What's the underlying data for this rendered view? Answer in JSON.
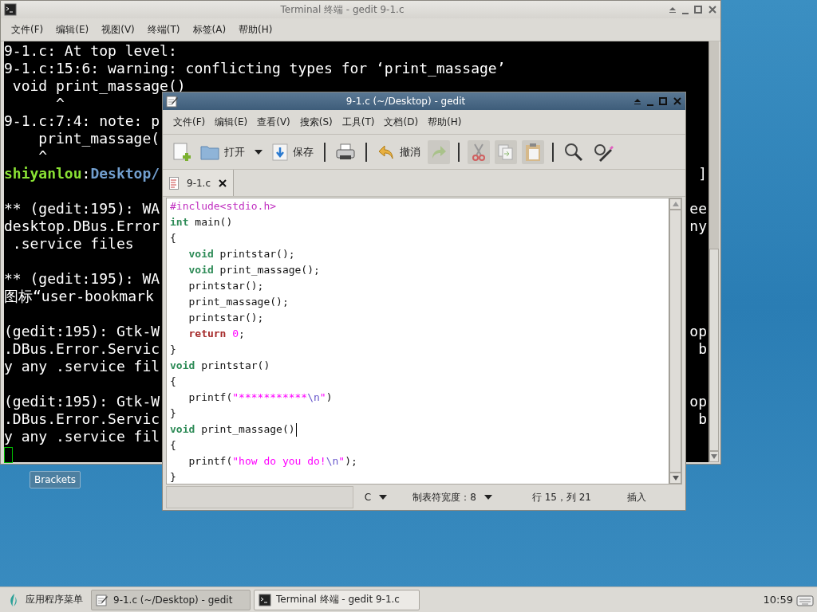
{
  "terminal": {
    "title": "Terminal 终端 - gedit 9-1.c",
    "menu": [
      "文件(F)",
      "编辑(E)",
      "视图(V)",
      "终端(T)",
      "标签(A)",
      "帮助(H)"
    ],
    "lines": [
      {
        "kind": "text",
        "segments": [
          {
            "text": "9-1.c: At top level:",
            "kind": "plain"
          }
        ]
      },
      {
        "kind": "text",
        "segments": [
          {
            "text": "9-1.c:15:6: warning: conflicting types for ‘print_massage’",
            "kind": "plain"
          }
        ]
      },
      {
        "kind": "text",
        "segments": [
          {
            "text": " void print_massage()",
            "kind": "plain"
          }
        ]
      },
      {
        "kind": "text",
        "segments": [
          {
            "text": "      ^",
            "kind": "plain"
          }
        ]
      },
      {
        "kind": "text",
        "segments": [
          {
            "text": "9-1.c:7:4: note: p",
            "kind": "plain"
          }
        ]
      },
      {
        "kind": "text",
        "segments": [
          {
            "text": "    print_massage(",
            "kind": "plain"
          }
        ]
      },
      {
        "kind": "text",
        "segments": [
          {
            "text": "    ^",
            "kind": "plain"
          }
        ]
      },
      {
        "kind": "text",
        "segments": [
          {
            "text": "shiyanlou",
            "kind": "user"
          },
          {
            "text": ":",
            "kind": "plain"
          },
          {
            "text": "Desktop/",
            "kind": "path"
          }
        ],
        "right": "]"
      },
      {
        "kind": "blank"
      },
      {
        "kind": "text",
        "segments": [
          {
            "text": "** (gedit:195): WA",
            "kind": "plain"
          }
        ],
        "right": "ee"
      },
      {
        "kind": "text",
        "segments": [
          {
            "text": "desktop.DBus.Error",
            "kind": "plain"
          }
        ],
        "right": "ny"
      },
      {
        "kind": "text",
        "segments": [
          {
            "text": " .service files",
            "kind": "plain"
          }
        ]
      },
      {
        "kind": "blank"
      },
      {
        "kind": "text",
        "segments": [
          {
            "text": "** (gedit:195): WA",
            "kind": "plain"
          }
        ]
      },
      {
        "kind": "text",
        "segments": [
          {
            "text": "图标“user-bookmark",
            "kind": "plain"
          }
        ]
      },
      {
        "kind": "blank"
      },
      {
        "kind": "text",
        "segments": [
          {
            "text": "(gedit:195): Gtk-W",
            "kind": "plain"
          }
        ],
        "right": "op"
      },
      {
        "kind": "text",
        "segments": [
          {
            "text": ".DBus.Error.Servic",
            "kind": "plain"
          }
        ],
        "right": "b"
      },
      {
        "kind": "text",
        "segments": [
          {
            "text": "y any .service fil",
            "kind": "plain"
          }
        ]
      },
      {
        "kind": "blank"
      },
      {
        "kind": "text",
        "segments": [
          {
            "text": "(gedit:195): Gtk-W",
            "kind": "plain"
          }
        ],
        "right": "op"
      },
      {
        "kind": "text",
        "segments": [
          {
            "text": ".DBus.Error.Servic",
            "kind": "plain"
          }
        ],
        "right": "b"
      },
      {
        "kind": "text",
        "segments": [
          {
            "text": "y any .service fil",
            "kind": "plain"
          }
        ]
      }
    ],
    "cursor": true
  },
  "tooltip": "Brackets",
  "gedit": {
    "title": "9-1.c (~/Desktop) - gedit",
    "menu": [
      "文件(F)",
      "编辑(E)",
      "查看(V)",
      "搜索(S)",
      "工具(T)",
      "文档(D)",
      "帮助(H)"
    ],
    "toolbar": {
      "open_label": "打开",
      "save_label": "保存",
      "undo_label": "撤消",
      "redo_disabled": true,
      "cut_disabled": true,
      "copy_disabled": true,
      "paste_disabled": true
    },
    "tabs": [
      {
        "label": "9-1.c",
        "selected": true
      }
    ],
    "code": [
      {
        "caret": false,
        "tokens": [
          {
            "kind": "preproc",
            "text": "#include<stdio.h>"
          }
        ]
      },
      {
        "caret": false,
        "tokens": [
          {
            "kind": "type",
            "text": "int"
          },
          {
            "kind": "plain",
            "text": " main()"
          }
        ]
      },
      {
        "caret": false,
        "tokens": [
          {
            "kind": "plain",
            "text": "{"
          }
        ]
      },
      {
        "caret": false,
        "tokens": [
          {
            "kind": "type",
            "text": "   void"
          },
          {
            "kind": "plain",
            "text": " printstar();"
          }
        ]
      },
      {
        "caret": false,
        "tokens": [
          {
            "kind": "type",
            "text": "   void"
          },
          {
            "kind": "plain",
            "text": " print_massage();"
          }
        ]
      },
      {
        "caret": false,
        "tokens": [
          {
            "kind": "plain",
            "text": "   printstar();"
          }
        ]
      },
      {
        "caret": false,
        "tokens": [
          {
            "kind": "plain",
            "text": "   print_massage();"
          }
        ]
      },
      {
        "caret": false,
        "tokens": [
          {
            "kind": "plain",
            "text": "   printstar();"
          }
        ]
      },
      {
        "caret": false,
        "tokens": [
          {
            "kind": "keyword",
            "text": "   return"
          },
          {
            "kind": "number",
            "text": " 0"
          },
          {
            "kind": "plain",
            "text": ";"
          }
        ]
      },
      {
        "caret": false,
        "tokens": [
          {
            "kind": "plain",
            "text": "}"
          }
        ]
      },
      {
        "caret": false,
        "tokens": [
          {
            "kind": "type",
            "text": "void"
          },
          {
            "kind": "plain",
            "text": " printstar()"
          }
        ]
      },
      {
        "caret": false,
        "tokens": [
          {
            "kind": "plain",
            "text": "{"
          }
        ]
      },
      {
        "caret": false,
        "tokens": [
          {
            "kind": "plain",
            "text": "   printf("
          },
          {
            "kind": "string",
            "text": "\"***********"
          },
          {
            "kind": "escape",
            "text": "\\n"
          },
          {
            "kind": "string",
            "text": "\""
          },
          {
            "kind": "plain",
            "text": ")"
          }
        ]
      },
      {
        "caret": false,
        "tokens": [
          {
            "kind": "plain",
            "text": "}"
          }
        ]
      },
      {
        "caret": true,
        "tokens": [
          {
            "kind": "type",
            "text": "void"
          },
          {
            "kind": "plain",
            "text": " print_massage()"
          }
        ]
      },
      {
        "caret": false,
        "tokens": [
          {
            "kind": "plain",
            "text": "{"
          }
        ]
      },
      {
        "caret": false,
        "tokens": [
          {
            "kind": "plain",
            "text": "   printf("
          },
          {
            "kind": "string",
            "text": "\"how do you do!"
          },
          {
            "kind": "escape",
            "text": "\\n"
          },
          {
            "kind": "string",
            "text": "\""
          },
          {
            "kind": "plain",
            "text": ");"
          }
        ]
      },
      {
        "caret": false,
        "tokens": [
          {
            "kind": "plain",
            "text": "}"
          }
        ]
      }
    ],
    "status": [
      {
        "kind": "dropdown",
        "text": "C"
      },
      {
        "kind": "dropdown",
        "text": "制表符宽度：8"
      },
      {
        "kind": "label",
        "text": "行 15，列 21"
      },
      {
        "kind": "label",
        "text": "插入"
      }
    ]
  },
  "taskbar": {
    "menu": "应用程序菜单",
    "tasks": [
      {
        "label": "9-1.c (~/Desktop) - gedit",
        "selected": true,
        "kind": "editor"
      },
      {
        "label": "Terminal 终端 - gedit 9-1.c",
        "selected": false,
        "kind": "terminal"
      }
    ],
    "clock": "10:59"
  }
}
